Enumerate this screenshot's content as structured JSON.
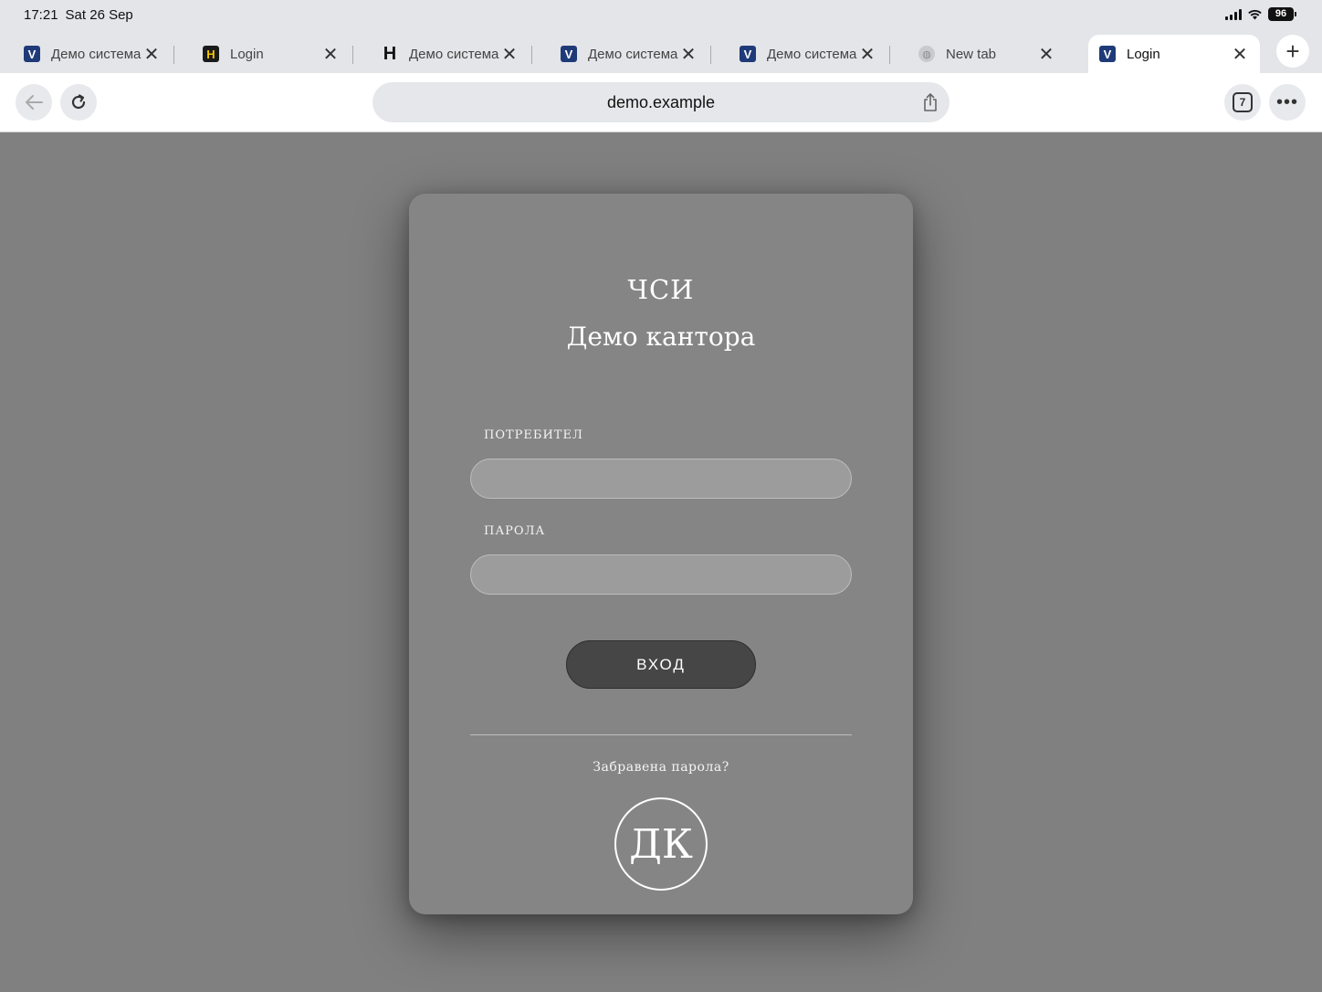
{
  "status": {
    "time": "17:21",
    "date": "Sat 26 Sep",
    "battery": "96"
  },
  "tabs": [
    {
      "label": "Демо система",
      "icon": "v-logo-icon"
    },
    {
      "label": "Login",
      "icon": "h-logo-icon"
    },
    {
      "label": "Демо система",
      "icon": "h-bold-logo-icon"
    },
    {
      "label": "Демо система",
      "icon": "v-logo-icon"
    },
    {
      "label": "Демо система",
      "icon": "v-logo-icon"
    },
    {
      "label": "New tab",
      "icon": "globe-icon"
    },
    {
      "label": "Login",
      "icon": "v-logo-icon",
      "active": true
    }
  ],
  "toolbar": {
    "url": "demo.example",
    "tab_count": "7"
  },
  "login": {
    "brand_line1": "ЧСИ",
    "brand_line2": "Демо кантора",
    "username_label": "ПОТРЕБИТЕЛ",
    "username_value": "",
    "password_label": "ПАРОЛА",
    "password_value": "",
    "submit_label": "ВХОД",
    "forgot_label": "Забравена парола?",
    "logo_text": "ДК"
  },
  "colors": {
    "page_bg": "#808080",
    "card_bg": "#858585",
    "button_bg": "#464646",
    "chrome_bg": "#e4e5e9"
  }
}
